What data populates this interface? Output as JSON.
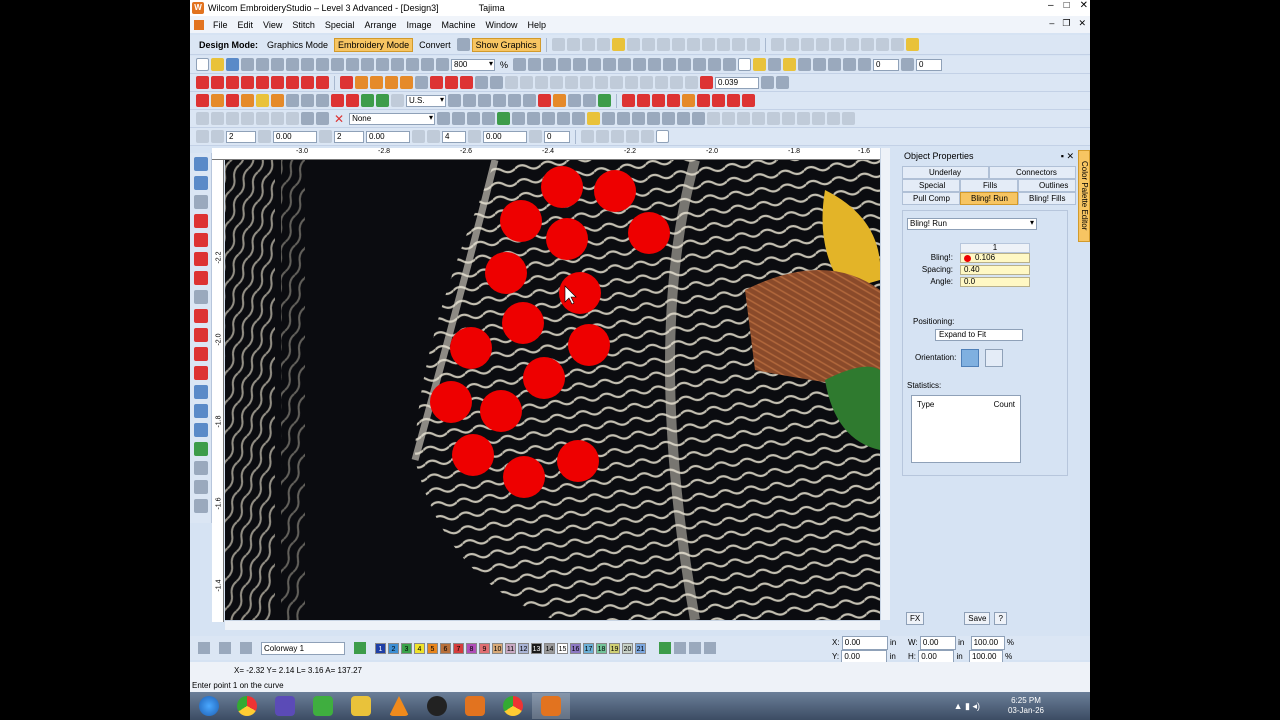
{
  "window": {
    "title": "Wilcom EmbroideryStudio – Level 3 Advanced - [Design3]",
    "tajima": "Tajima",
    "minimize": "–",
    "maximize": "□",
    "close": "✕"
  },
  "menu": {
    "items": [
      "File",
      "Edit",
      "View",
      "Stitch",
      "Special",
      "Arrange",
      "Image",
      "Machine",
      "Window",
      "Help"
    ],
    "mdi_minimize": "–",
    "mdi_restore": "❐",
    "mdi_close": "✕"
  },
  "toolbar1": {
    "design_mode_label": "Design Mode:",
    "graphics_mode": "Graphics Mode",
    "embroidery_mode": "Embroidery Mode",
    "convert": "Convert",
    "show_graphics": "Show Graphics"
  },
  "toolbar2": {
    "zoom_value": "800",
    "zoom_unit": "%",
    "field_a": "0",
    "field_b": "0"
  },
  "toolbar3": {
    "bling_value": "0.039"
  },
  "toolbar4": {
    "units": "U.S."
  },
  "toolbar5": {
    "fill_name": "None"
  },
  "toolbar6": {
    "v1": "2",
    "v2": "0.00",
    "v3": "2",
    "v4": "0.00",
    "v5": "4",
    "v6": "0.00",
    "v7": "0"
  },
  "ruler": {
    "h_ticks": [
      "-3.0",
      "-2.8",
      "-2.6",
      "-2.4",
      "-2.2",
      "-2.0",
      "-1.8",
      "-1.6"
    ],
    "v_ticks": [
      "-2.2",
      "-2.0",
      "-1.8",
      "-1.6",
      "-1.4"
    ]
  },
  "panel": {
    "title": "Object Properties",
    "pin": "▪",
    "close": "✕",
    "tabs_row1": [
      "Underlay",
      "Connectors"
    ],
    "tabs_row2": [
      "Special",
      "Fills",
      "Outlines"
    ],
    "tabs_row3": [
      "Pull Comp",
      "Bling! Run",
      "Bling! Fills"
    ],
    "active_tab": "Bling! Run",
    "type_select": "Bling! Run",
    "column_number": "1",
    "bling_label": "Bling!:",
    "bling_value": "0.106",
    "spacing_label": "Spacing:",
    "spacing_value": "0.40",
    "angle_label": "Angle:",
    "angle_value": "0.0",
    "positioning_label": "Positioning:",
    "positioning_value": "Expand to Fit",
    "orientation_label": "Orientation:",
    "statistics_label": "Statistics:",
    "stats_col_type": "Type",
    "stats_col_count": "Count",
    "fx_button": "FX",
    "save_button": "Save",
    "help_button": "?",
    "color_palette_editor": "Color Palette Editor"
  },
  "bottom": {
    "colorway": "Colorway 1",
    "colors": [
      {
        "n": "1",
        "c": "#1f3fa6"
      },
      {
        "n": "2",
        "c": "#3c8fd4"
      },
      {
        "n": "3",
        "c": "#3aa34a"
      },
      {
        "n": "4",
        "c": "#f0e32a"
      },
      {
        "n": "5",
        "c": "#e8861e"
      },
      {
        "n": "6",
        "c": "#b8703a"
      },
      {
        "n": "7",
        "c": "#d43c3c"
      },
      {
        "n": "8",
        "c": "#b04fb8"
      },
      {
        "n": "9",
        "c": "#e06f72"
      },
      {
        "n": "10",
        "c": "#d9aa78"
      },
      {
        "n": "11",
        "c": "#c9a9c2"
      },
      {
        "n": "12",
        "c": "#a9b4d6"
      },
      {
        "n": "13",
        "c": "#1a1a1a"
      },
      {
        "n": "14",
        "c": "#9a9a9a"
      },
      {
        "n": "15",
        "c": "#ffffff"
      },
      {
        "n": "16",
        "c": "#8d79c3"
      },
      {
        "n": "17",
        "c": "#6bb0d6"
      },
      {
        "n": "18",
        "c": "#74c49a"
      },
      {
        "n": "19",
        "c": "#cfcf74"
      },
      {
        "n": "20",
        "c": "#c9d3c8"
      },
      {
        "n": "21",
        "c": "#7ca7df"
      }
    ],
    "x_label": "X:",
    "x_value": "0.00",
    "y_label": "Y:",
    "y_value": "0.00",
    "w_label": "W:",
    "w_value": "0.00",
    "h_label": "H:",
    "h_value": "0.00",
    "unit": "in",
    "pw": "100.00",
    "ph": "100.00",
    "pct": "%"
  },
  "status": {
    "coords": "X=  -2.32 Y=   2.14 L=   3.16 A= 137.27",
    "message": "Enter point 1 on the curve"
  },
  "taskbar": {
    "time": "6:25 PM",
    "date": "03-Jan-26"
  },
  "colors": {
    "accent": "#f7c562",
    "chrome": "#d6e3f3",
    "bling_dot": "#ee0000"
  }
}
